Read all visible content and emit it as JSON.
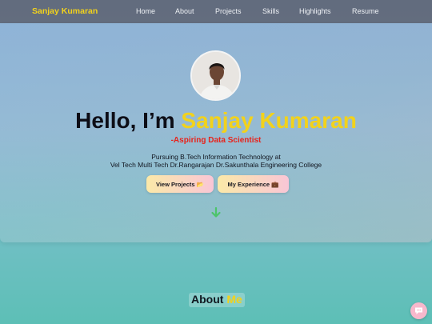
{
  "navbar": {
    "brand": "Sanjay Kumaran",
    "links": [
      "Home",
      "About",
      "Projects",
      "Skills",
      "Highlights",
      "Resume"
    ]
  },
  "hero": {
    "greeting": "Hello, I’m ",
    "name": "Sanjay Kumaran",
    "subtitle": "-Aspiring Data Scientist",
    "description_line1": "Pursuing B.Tech Information Technology at",
    "description_line2": "Vel Tech Multi Tech Dr.Rangarajan Dr.Sakunthala Engineering College",
    "buttons": {
      "projects": "View Projects 📂",
      "experience": "My Experience 💼"
    }
  },
  "about": {
    "title_main": "About",
    "title_accent": "Me"
  },
  "colors": {
    "accent": "#f2d21c",
    "subtitle": "#e8221a",
    "scroll_arrow": "#4cc46a"
  },
  "icons": {
    "scroll": "arrow-down-icon",
    "chat": "chat-icon"
  }
}
